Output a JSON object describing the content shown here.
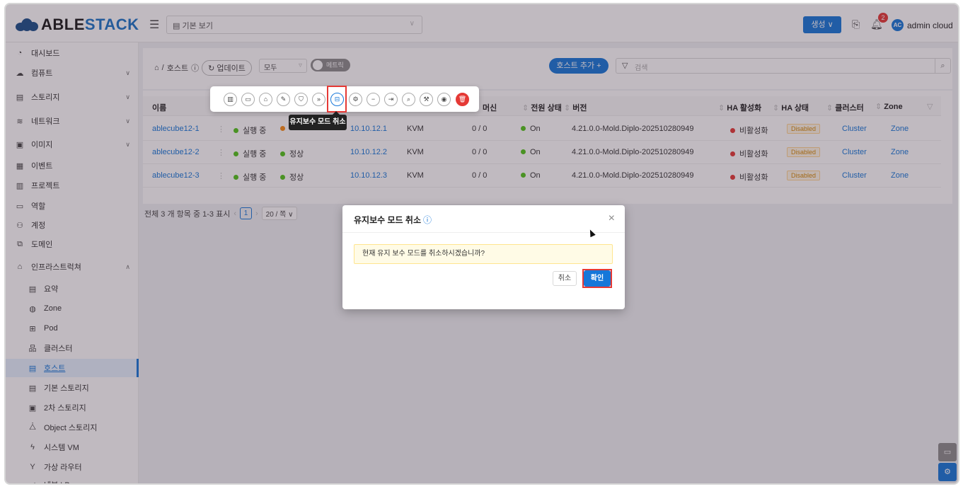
{
  "header": {
    "logo_able": "ABLE",
    "logo_stack": "STACK",
    "view_select": "기본 보기",
    "create_label": "생성",
    "notification_count": "2",
    "avatar_initials": "AC",
    "username": "admin cloud"
  },
  "sidebar": {
    "items": [
      {
        "label": "대시보드",
        "icon": "dashboard-icon"
      },
      {
        "label": "컴퓨트",
        "icon": "cloud-icon"
      },
      {
        "label": "스토리지",
        "icon": "storage-icon"
      },
      {
        "label": "네트워크",
        "icon": "wifi-icon"
      },
      {
        "label": "이미지",
        "icon": "image-icon"
      },
      {
        "label": "이벤트",
        "icon": "calendar-icon"
      },
      {
        "label": "프로젝트",
        "icon": "project-icon"
      },
      {
        "label": "역할",
        "icon": "role-icon"
      },
      {
        "label": "계정",
        "icon": "account-icon"
      },
      {
        "label": "도메인",
        "icon": "domain-icon"
      },
      {
        "label": "인프라스트럭쳐",
        "icon": "bank-icon"
      }
    ],
    "sub_items": [
      {
        "label": "요약"
      },
      {
        "label": "Zone"
      },
      {
        "label": "Pod"
      },
      {
        "label": "클러스터"
      },
      {
        "label": "호스트"
      },
      {
        "label": "기본 스토리지"
      },
      {
        "label": "2차 스토리지"
      },
      {
        "label": "Object 스토리지"
      },
      {
        "label": "시스템 VM"
      },
      {
        "label": "가상 라우터"
      },
      {
        "label": "내부 LB"
      }
    ]
  },
  "toolbar": {
    "breadcrumb_host": "호스트",
    "refresh_label": "업데이트",
    "filter_value": "모두",
    "metrics_label": "메트릭",
    "add_host_label": "호스트 추가 +",
    "search_placeholder": "검색"
  },
  "table": {
    "headers": [
      "이름",
      "머신",
      "전원 상태",
      "버전",
      "HA 활성화",
      "HA 상태",
      "클러스터",
      "Zone"
    ],
    "rows": [
      {
        "name": "ablecube12-1",
        "state": "실행 중",
        "ip": "10.10.12.1",
        "hyper": "KVM",
        "vms": "0 / 0",
        "power": "On",
        "version": "4.21.0.0-Mold.Diplo-202510280949",
        "ha_enabled": "비활성화",
        "ha_state": "Disabled",
        "cluster": "Cluster",
        "zone": "Zone"
      },
      {
        "name": "ablecube12-2",
        "state": "실행 중",
        "resource": "정상",
        "ip": "10.10.12.2",
        "hyper": "KVM",
        "vms": "0 / 0",
        "power": "On",
        "version": "4.21.0.0-Mold.Diplo-202510280949",
        "ha_enabled": "비활성화",
        "ha_state": "Disabled",
        "cluster": "Cluster",
        "zone": "Zone"
      },
      {
        "name": "ablecube12-3",
        "state": "실행 중",
        "resource": "정상",
        "ip": "10.10.12.3",
        "hyper": "KVM",
        "vms": "0 / 0",
        "power": "On",
        "version": "4.21.0.0-Mold.Diplo-202510280949",
        "ha_enabled": "비활성화",
        "ha_state": "Disabled",
        "cluster": "Cluster",
        "zone": "Zone"
      }
    ]
  },
  "pagination": {
    "summary": "전체 3 개 항목 중 1-3 표시",
    "current_page": "1",
    "page_size": "20 / 쪽"
  },
  "action_tooltip": "유지보수 모드 취소",
  "modal": {
    "title": "유지보수 모드 취소",
    "message": "현재 유지 보수 모드를 취소하시겠습니까?",
    "cancel_label": "취소",
    "ok_label": "확인"
  },
  "colors": {
    "primary": "#1677d9",
    "danger": "#e53935",
    "running": "#52c41a",
    "warning": "#fa8c16"
  }
}
